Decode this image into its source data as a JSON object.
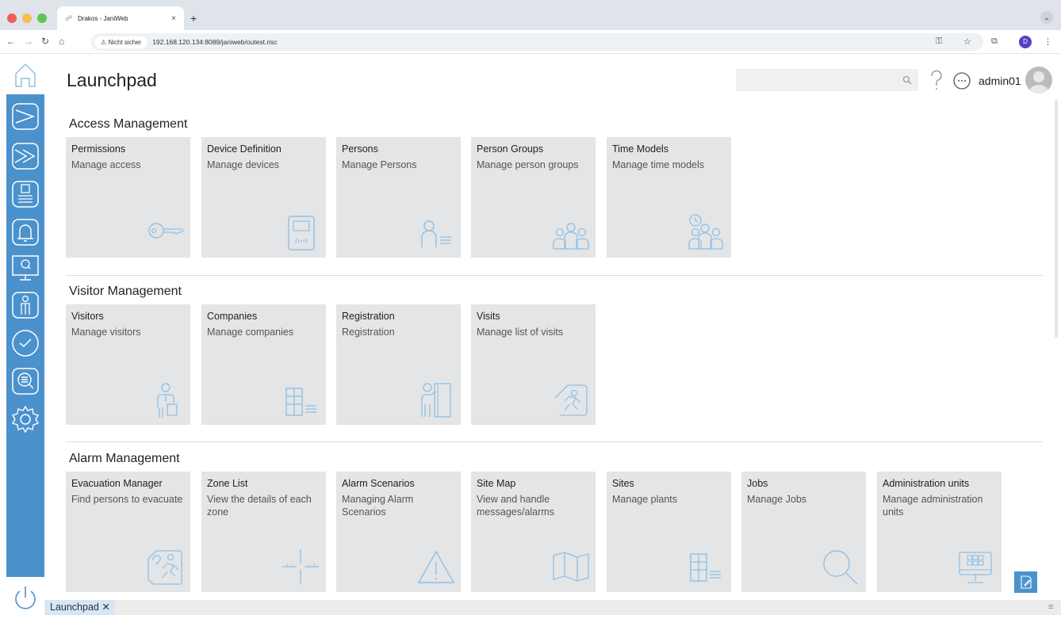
{
  "browser": {
    "tab_title": "Drakos - JaniWeb",
    "tab_close": "×",
    "new_tab": "+",
    "not_secure": "Nicht sicher",
    "url": "192.168.120.134:8089/janiweb/outest.risc",
    "profile_initial": "D"
  },
  "header": {
    "title": "Launchpad",
    "search_placeholder": "",
    "username": "admin01"
  },
  "sections": [
    {
      "title": "Access Management",
      "tiles": [
        {
          "title": "Permissions",
          "subtitle": "Manage access",
          "icon": "key-icon"
        },
        {
          "title": "Device Definition",
          "subtitle": "Manage devices",
          "icon": "card-reader-icon"
        },
        {
          "title": "Persons",
          "subtitle": "Manage Persons",
          "icon": "person-list-icon"
        },
        {
          "title": "Person Groups",
          "subtitle": "Manage person groups",
          "icon": "person-group-icon"
        },
        {
          "title": "Time Models",
          "subtitle": "Manage time models",
          "icon": "time-group-icon"
        }
      ]
    },
    {
      "title": "Visitor Management",
      "tiles": [
        {
          "title": "Visitors",
          "subtitle": "Manage visitors",
          "icon": "visitor-icon"
        },
        {
          "title": "Companies",
          "subtitle": "Manage companies",
          "icon": "building-list-icon"
        },
        {
          "title": "Registration",
          "subtitle": "Registration",
          "icon": "registration-door-icon"
        },
        {
          "title": "Visits",
          "subtitle": "Manage list of visits",
          "icon": "visit-exit-icon"
        }
      ]
    },
    {
      "title": "Alarm Management",
      "tiles": [
        {
          "title": "Evacuation Manager",
          "subtitle": "Find persons to evacuate",
          "icon": "evacuation-icon"
        },
        {
          "title": "Zone List",
          "subtitle": "View the details of each zone",
          "icon": "crosshair-icon"
        },
        {
          "title": "Alarm Scenarios",
          "subtitle": "Managing Alarm Scenarios",
          "icon": "warning-icon"
        },
        {
          "title": "Site Map",
          "subtitle": "View and handle messages/alarms",
          "icon": "map-icon"
        },
        {
          "title": "Sites",
          "subtitle": "Manage plants",
          "icon": "building-list-icon"
        },
        {
          "title": "Jobs",
          "subtitle": "Manage Jobs",
          "icon": "magnifier-icon"
        },
        {
          "title": "Administration units",
          "subtitle": "Manage administration units",
          "icon": "monitor-grid-icon"
        }
      ]
    }
  ],
  "bottom": {
    "tab_label": "Launchpad",
    "tab_close": "✕"
  },
  "colors": {
    "sidebar": "#4b92cd",
    "tile_bg": "#e3e5e7",
    "tile_icon": "#8fc0e6"
  }
}
